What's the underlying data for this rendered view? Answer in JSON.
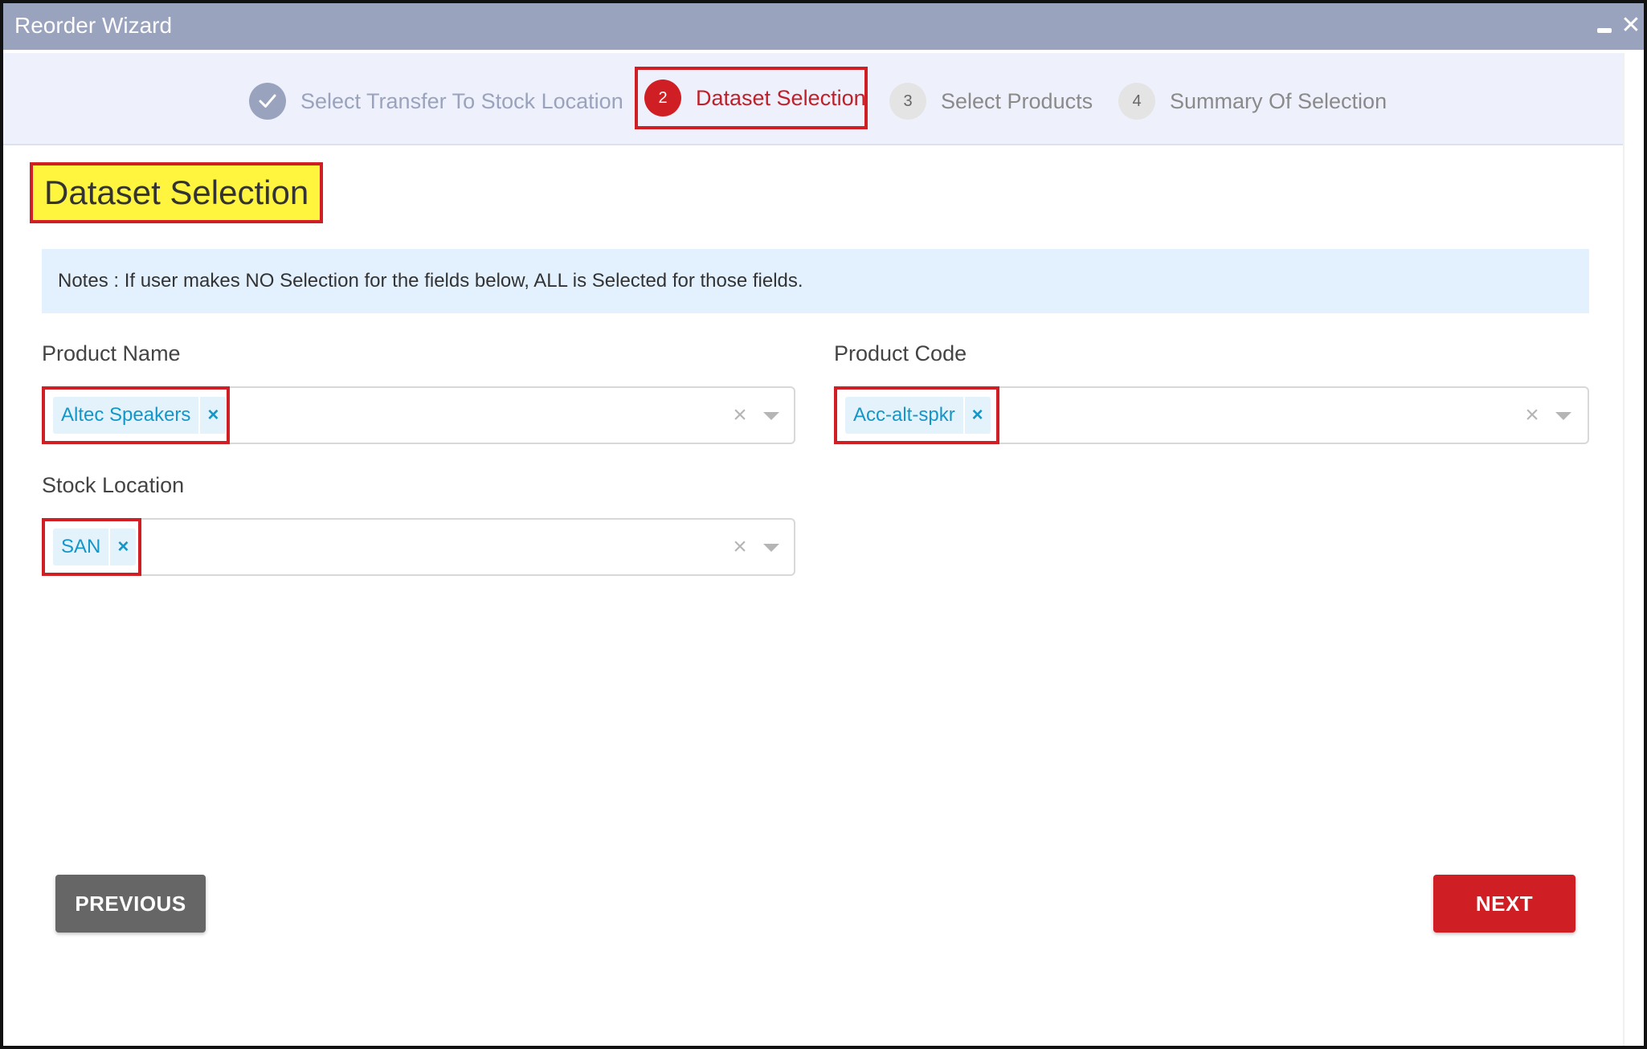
{
  "window": {
    "title": "Reorder Wizard",
    "minimize_icon": "minimize-icon",
    "close_icon": "close-icon"
  },
  "stepper": {
    "steps": [
      {
        "number": "",
        "label": "Select Transfer To Stock Location",
        "state": "completed",
        "icon": "check-icon"
      },
      {
        "number": "2",
        "label": "Dataset Selection",
        "state": "active"
      },
      {
        "number": "3",
        "label": "Select Products",
        "state": "pending"
      },
      {
        "number": "4",
        "label": "Summary Of Selection",
        "state": "pending"
      }
    ]
  },
  "page": {
    "heading": "Dataset Selection",
    "notes": "Notes : If user makes NO Selection for the fields below, ALL is Selected for those fields."
  },
  "fields": {
    "product_name": {
      "label": "Product Name",
      "selected": [
        "Altec Speakers"
      ]
    },
    "product_code": {
      "label": "Product Code",
      "selected": [
        "Acc-alt-spkr"
      ]
    },
    "stock_location": {
      "label": "Stock Location",
      "selected": [
        "SAN"
      ]
    }
  },
  "actions": {
    "previous_label": "PREVIOUS",
    "next_label": "NEXT"
  },
  "colors": {
    "titlebar": "#9aa3bd",
    "accent_red": "#d01f24",
    "highlight_yellow": "#fff53f",
    "chip_text": "#1596c8",
    "notes_bg": "#e3f1ff"
  }
}
